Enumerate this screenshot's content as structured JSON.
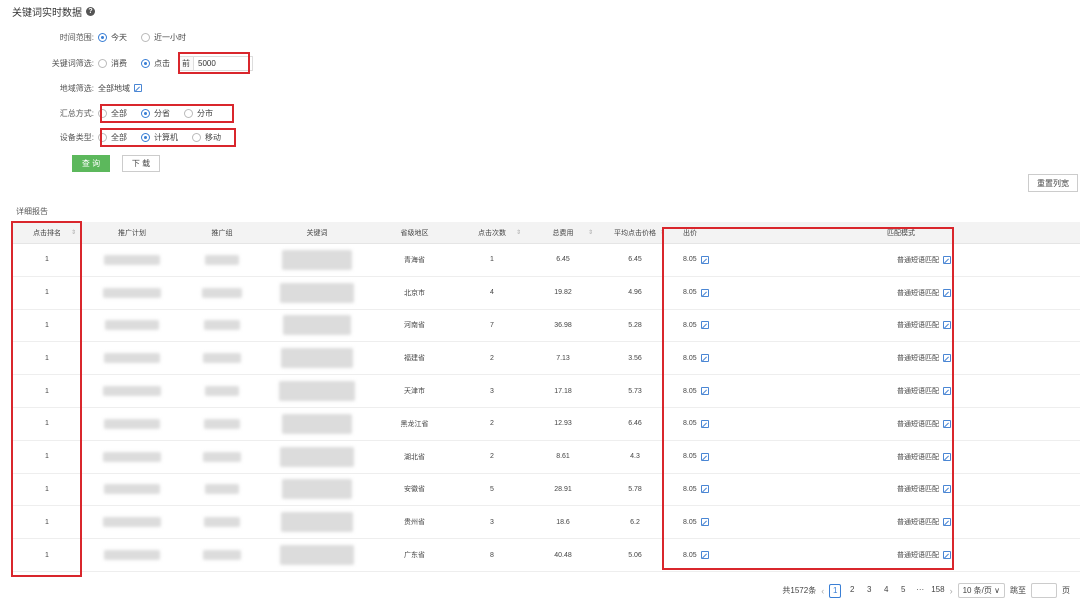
{
  "title": "关键词实时数据",
  "filters": {
    "time_range": {
      "label": "时间范围:",
      "options": [
        {
          "label": "今天",
          "checked": true
        },
        {
          "label": "近一小时",
          "checked": false
        }
      ]
    },
    "keyword_filter": {
      "label": "关键词筛选:",
      "options": [
        {
          "label": "消费",
          "checked": false
        },
        {
          "label": "点击",
          "checked": true
        }
      ],
      "prefix": "前",
      "value": "5000"
    },
    "region": {
      "label": "地域筛选:",
      "value": "全部地域"
    },
    "summary": {
      "label": "汇总方式:",
      "options": [
        {
          "label": "全部",
          "checked": false
        },
        {
          "label": "分省",
          "checked": true
        },
        {
          "label": "分市",
          "checked": false
        }
      ]
    },
    "device": {
      "label": "设备类型:",
      "options": [
        {
          "label": "全部",
          "checked": false
        },
        {
          "label": "计算机",
          "checked": true
        },
        {
          "label": "移动",
          "checked": false
        }
      ]
    }
  },
  "buttons": {
    "query": "查 询",
    "download": "下 载",
    "reset": "重置列宽"
  },
  "section_title": "详细报告",
  "table": {
    "headers": [
      "点击排名",
      "推广计划",
      "推广组",
      "关键词",
      "省级地区",
      "点击次数",
      "总费用",
      "平均点击价格",
      "出价",
      "匹配模式"
    ],
    "rows": [
      {
        "rank": "1",
        "region": "青海省",
        "clicks": "1",
        "cost": "6.45",
        "avg": "6.45",
        "bid": "8.05",
        "match": "普通短语匹配"
      },
      {
        "rank": "1",
        "region": "北京市",
        "clicks": "4",
        "cost": "19.82",
        "avg": "4.96",
        "bid": "8.05",
        "match": "普通短语匹配"
      },
      {
        "rank": "1",
        "region": "河南省",
        "clicks": "7",
        "cost": "36.98",
        "avg": "5.28",
        "bid": "8.05",
        "match": "普通短语匹配"
      },
      {
        "rank": "1",
        "region": "福建省",
        "clicks": "2",
        "cost": "7.13",
        "avg": "3.56",
        "bid": "8.05",
        "match": "普通短语匹配"
      },
      {
        "rank": "1",
        "region": "天津市",
        "clicks": "3",
        "cost": "17.18",
        "avg": "5.73",
        "bid": "8.05",
        "match": "普通短语匹配"
      },
      {
        "rank": "1",
        "region": "黑龙江省",
        "clicks": "2",
        "cost": "12.93",
        "avg": "6.46",
        "bid": "8.05",
        "match": "普通短语匹配"
      },
      {
        "rank": "1",
        "region": "湖北省",
        "clicks": "2",
        "cost": "8.61",
        "avg": "4.3",
        "bid": "8.05",
        "match": "普通短语匹配"
      },
      {
        "rank": "1",
        "region": "安徽省",
        "clicks": "5",
        "cost": "28.91",
        "avg": "5.78",
        "bid": "8.05",
        "match": "普通短语匹配"
      },
      {
        "rank": "1",
        "region": "贵州省",
        "clicks": "3",
        "cost": "18.6",
        "avg": "6.2",
        "bid": "8.05",
        "match": "普通短语匹配"
      },
      {
        "rank": "1",
        "region": "广东省",
        "clicks": "8",
        "cost": "40.48",
        "avg": "5.06",
        "bid": "8.05",
        "match": "普通短语匹配"
      }
    ]
  },
  "pagination": {
    "total": "共1572条",
    "pages": [
      "1",
      "2",
      "3",
      "4",
      "5",
      "···",
      "158"
    ],
    "page_size": "10 条/页",
    "jump_label": "跳至",
    "page_suffix": "页"
  },
  "colors": {
    "accent": "#3a7fd5",
    "query_button": "#5cb85c",
    "highlight": "#d9262c"
  }
}
